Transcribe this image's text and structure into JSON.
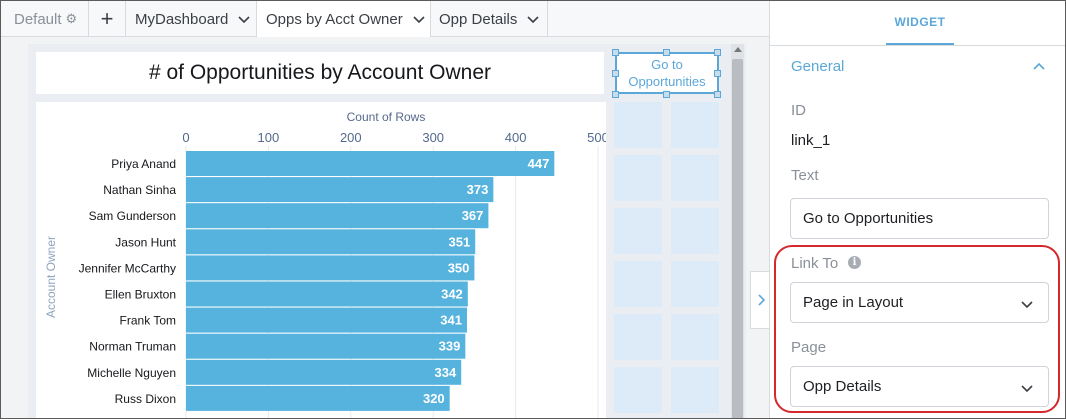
{
  "tabs": {
    "default_label": "Default",
    "add_label": "+",
    "items": [
      {
        "label": "MyDashboard"
      },
      {
        "label": "Opps by Acct Owner"
      },
      {
        "label": "Opp Details"
      }
    ]
  },
  "canvas": {
    "title": "# of Opportunities by Account Owner",
    "link_widget_text": "Go to Opportunities"
  },
  "chart_data": {
    "type": "bar",
    "orientation": "horizontal",
    "title": "",
    "xlabel": "Count of Rows",
    "ylabel": "Account Owner",
    "xlim": [
      0,
      500
    ],
    "xticks": [
      "0",
      "100",
      "200",
      "300",
      "400",
      "500"
    ],
    "categories": [
      "Priya Anand",
      "Nathan Sinha",
      "Sam Gunderson",
      "Jason Hunt",
      "Jennifer McCarthy",
      "Ellen Bruxton",
      "Frank Tom",
      "Norman Truman",
      "Michelle Nguyen",
      "Russ Dixon"
    ],
    "values": [
      447,
      373,
      367,
      351,
      350,
      342,
      341,
      339,
      334,
      320
    ],
    "bar_color": "#55b3de",
    "grid": true
  },
  "panel": {
    "tab_label": "WIDGET",
    "section_label": "General",
    "id_label": "ID",
    "id_value": "link_1",
    "text_label": "Text",
    "text_value": "Go to Opportunities",
    "link_to_label": "Link To",
    "link_to_value": "Page in Layout",
    "page_label": "Page",
    "page_value": "Opp Details"
  },
  "colors": {
    "accent": "#5ba7d8",
    "highlight": "#d4282d"
  }
}
